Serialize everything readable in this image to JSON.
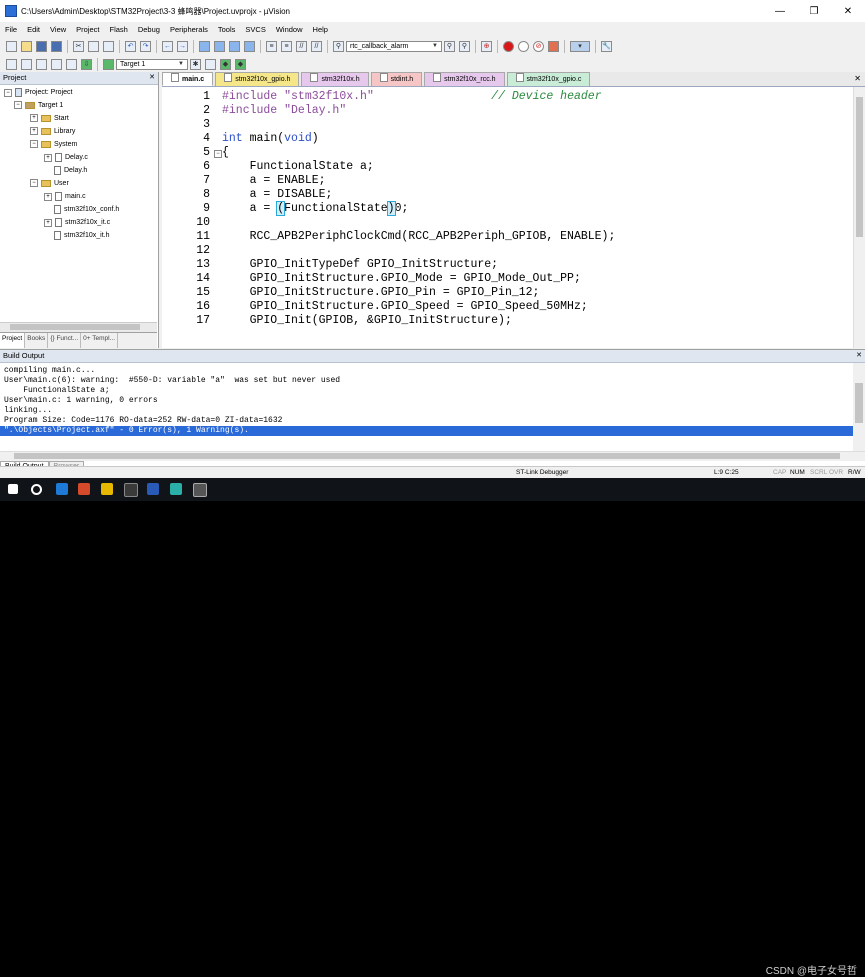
{
  "window": {
    "title": "C:\\Users\\Admin\\Desktop\\STM32Project\\3-3 蜂鸣器\\Project.uvprojx - µVision",
    "controls": [
      "—",
      "❐",
      "✕"
    ]
  },
  "menu": [
    "File",
    "Edit",
    "View",
    "Project",
    "Flash",
    "Debug",
    "Peripherals",
    "Tools",
    "SVCS",
    "Window",
    "Help"
  ],
  "toolbar": {
    "function_combo": "rtc_callback_alarm",
    "target_combo": "Target 1"
  },
  "project_pane": {
    "title": "Project",
    "close": "✕",
    "tree": [
      {
        "label": "Project: Project",
        "level": 0,
        "type": "root",
        "expander": "−"
      },
      {
        "label": "Target 1",
        "level": 1,
        "type": "target",
        "expander": "−"
      },
      {
        "label": "Start",
        "level": 2,
        "type": "folder",
        "expander": "+"
      },
      {
        "label": "Library",
        "level": 2,
        "type": "folder",
        "expander": "+"
      },
      {
        "label": "System",
        "level": 2,
        "type": "folder",
        "expander": "−"
      },
      {
        "label": "Delay.c",
        "level": 3,
        "type": "file",
        "expander": "+"
      },
      {
        "label": "Delay.h",
        "level": 3,
        "type": "file",
        "expander": ""
      },
      {
        "label": "User",
        "level": 2,
        "type": "folder",
        "expander": "−"
      },
      {
        "label": "main.c",
        "level": 3,
        "type": "file",
        "expander": "+"
      },
      {
        "label": "stm32f10x_conf.h",
        "level": 3,
        "type": "file",
        "expander": ""
      },
      {
        "label": "stm32f10x_it.c",
        "level": 3,
        "type": "file",
        "expander": "+"
      },
      {
        "label": "stm32f10x_it.h",
        "level": 3,
        "type": "file",
        "expander": ""
      }
    ],
    "tabs": [
      "Project",
      "Books",
      "{} Funct...",
      "0+ Templ..."
    ]
  },
  "editor": {
    "tabs": [
      {
        "label": "main.c",
        "color": "#ffffff",
        "active": true
      },
      {
        "label": "stm32f10x_gpio.h",
        "color": "#f5e68a",
        "active": false
      },
      {
        "label": "stm32f10x.h",
        "color": "#e6c8ec",
        "active": false
      },
      {
        "label": "stdint.h",
        "color": "#f6c6c6",
        "active": false
      },
      {
        "label": "stm32f10x_rcc.h",
        "color": "#e6c8ec",
        "active": false
      },
      {
        "label": "stm32f10x_gpio.c",
        "color": "#c8ecd6",
        "active": false
      }
    ],
    "tabs_close": "✕",
    "lines": [
      {
        "n": "1",
        "fold": "",
        "segs": [
          {
            "t": "#include ",
            "c": "pp"
          },
          {
            "t": "\"stm32f10x.h\"",
            "c": "str"
          },
          {
            "t": "                 ",
            "c": ""
          },
          {
            "t": "// Device header",
            "c": "cm"
          }
        ]
      },
      {
        "n": "2",
        "fold": "",
        "segs": [
          {
            "t": "#include ",
            "c": "pp"
          },
          {
            "t": "\"Delay.h\"",
            "c": "str"
          }
        ]
      },
      {
        "n": "3",
        "fold": "",
        "segs": []
      },
      {
        "n": "4",
        "fold": "",
        "segs": [
          {
            "t": "int",
            "c": "kw"
          },
          {
            "t": " main(",
            "c": ""
          },
          {
            "t": "void",
            "c": "kw"
          },
          {
            "t": ")",
            "c": ""
          }
        ]
      },
      {
        "n": "5",
        "fold": "−",
        "segs": [
          {
            "t": "{",
            "c": ""
          }
        ]
      },
      {
        "n": "6",
        "fold": "",
        "segs": [
          {
            "t": "    FunctionalState a;",
            "c": ""
          }
        ]
      },
      {
        "n": "7",
        "fold": "",
        "segs": [
          {
            "t": "    a = ENABLE;",
            "c": ""
          }
        ]
      },
      {
        "n": "8",
        "fold": "",
        "segs": [
          {
            "t": "    a = DISABLE;",
            "c": ""
          }
        ]
      },
      {
        "n": "9",
        "fold": "",
        "segs": [
          {
            "t": "    a = ",
            "c": ""
          },
          {
            "t": "(",
            "c": "hl"
          },
          {
            "t": "FunctionalState",
            "c": ""
          },
          {
            "t": ")",
            "c": "hl"
          },
          {
            "t": "0;",
            "c": ""
          }
        ]
      },
      {
        "n": "10",
        "fold": "",
        "segs": []
      },
      {
        "n": "11",
        "fold": "",
        "segs": [
          {
            "t": "    RCC_APB2PeriphClockCmd(RCC_APB2Periph_GPIOB, ENABLE);",
            "c": ""
          }
        ]
      },
      {
        "n": "12",
        "fold": "",
        "segs": []
      },
      {
        "n": "13",
        "fold": "",
        "segs": [
          {
            "t": "    GPIO_InitTypeDef GPIO_InitStructure;",
            "c": ""
          }
        ]
      },
      {
        "n": "14",
        "fold": "",
        "segs": [
          {
            "t": "    GPIO_InitStructure.GPIO_Mode = GPIO_Mode_Out_PP;",
            "c": ""
          }
        ]
      },
      {
        "n": "15",
        "fold": "",
        "segs": [
          {
            "t": "    GPIO_InitStructure.GPIO_Pin = GPIO_Pin_12;",
            "c": ""
          }
        ]
      },
      {
        "n": "16",
        "fold": "",
        "segs": [
          {
            "t": "    GPIO_InitStructure.GPIO_Speed = GPIO_Speed_50MHz;",
            "c": ""
          }
        ]
      },
      {
        "n": "17",
        "fold": "",
        "segs": [
          {
            "t": "    GPIO_Init(GPIOB, &GPIO_InitStructure);",
            "c": ""
          }
        ]
      }
    ]
  },
  "build_output": {
    "title": "Build Output",
    "close": "✕",
    "lines": [
      "compiling main.c...",
      "User\\main.c(6): warning:  #550-D: variable \"a\"  was set but never used",
      "    FunctionalState a;",
      "User\\main.c: 1 warning, 0 errors",
      "linking...",
      "Program Size: Code=1176 RO-data=252 RW-data=0 ZI-data=1632",
      "\".\\Objects\\Project.axf\" - 0 Error(s), 1 Warning(s)."
    ],
    "tabs": [
      "Build Output",
      "Browser"
    ]
  },
  "status": {
    "debugger": "ST-Link Debugger",
    "position": "L:9 C:25",
    "indicators": [
      "CAP",
      "NUM",
      "SCRL",
      "OVR",
      "R/W"
    ]
  },
  "watermark": "CSDN @电子女号哲"
}
